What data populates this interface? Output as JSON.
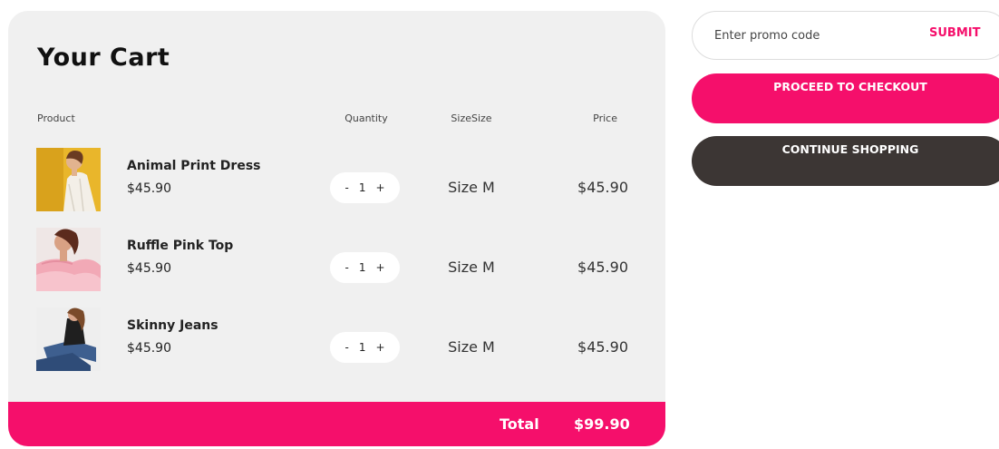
{
  "cart": {
    "title": "Your Cart",
    "headers": {
      "product": "Product",
      "quantity": "Quantity",
      "size": "SizeSize",
      "price": "Price"
    },
    "items": [
      {
        "name": "Animal Print Dress",
        "unit_price": "$45.90",
        "qty_minus": "-",
        "quantity": "1",
        "qty_plus": "+",
        "size": "Size M",
        "price": "$45.90"
      },
      {
        "name": "Ruffle Pink Top",
        "unit_price": "$45.90",
        "qty_minus": "-",
        "quantity": "1",
        "qty_plus": "+",
        "size": "Size M",
        "price": "$45.90"
      },
      {
        "name": "Skinny Jeans",
        "unit_price": "$45.90",
        "qty_minus": "-",
        "quantity": "1",
        "qty_plus": "+",
        "size": "Size M",
        "price": "$45.90"
      }
    ],
    "total_label": "Total",
    "total_value": "$99.90"
  },
  "promo": {
    "placeholder": "Enter promo code",
    "submit_label": "SUBMIT"
  },
  "actions": {
    "checkout_label": "PROCEED TO CHECKOUT",
    "continue_label": "CONTINUE SHOPPING"
  },
  "colors": {
    "accent": "#f50f6b",
    "dark_button": "#3c3634",
    "cart_background": "#f0f0f0"
  }
}
